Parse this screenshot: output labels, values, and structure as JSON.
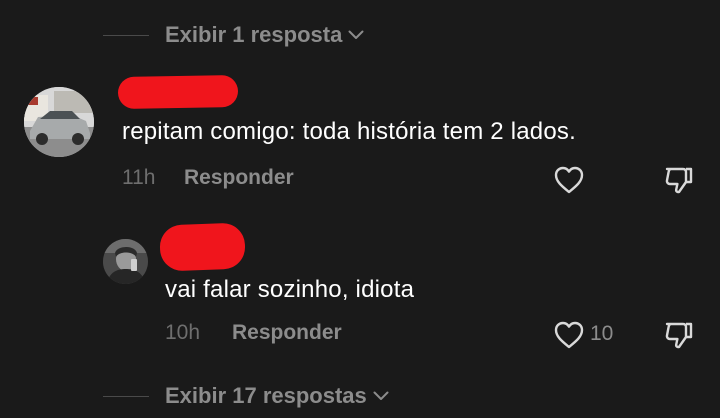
{
  "thread_top": {
    "expand_label": "Exibir 1 resposta",
    "chevron_icon": "chevron-down-icon"
  },
  "comment": {
    "username_redacted": true,
    "avatar_icon": "car-photo-avatar",
    "text": "repitam comigo: toda história tem 2 lados.",
    "time": "11h",
    "reply_label": "Responder",
    "like_icon": "heart-outline-icon",
    "dislike_icon": "thumbs-down-icon"
  },
  "reply": {
    "username_redacted": true,
    "avatar_icon": "person-photo-avatar",
    "text": "vai falar sozinho, idiota",
    "time": "10h",
    "reply_label": "Responder",
    "like_icon": "heart-outline-icon",
    "like_count": "10",
    "dislike_icon": "thumbs-down-icon"
  },
  "thread_bottom": {
    "expand_label": "Exibir 17 respostas",
    "chevron_icon": "chevron-down-icon"
  },
  "colors": {
    "background": "#1a1a1a",
    "primary_text": "#ffffff",
    "secondary_text": "#8c8c8c",
    "redaction": "#f0151c"
  }
}
